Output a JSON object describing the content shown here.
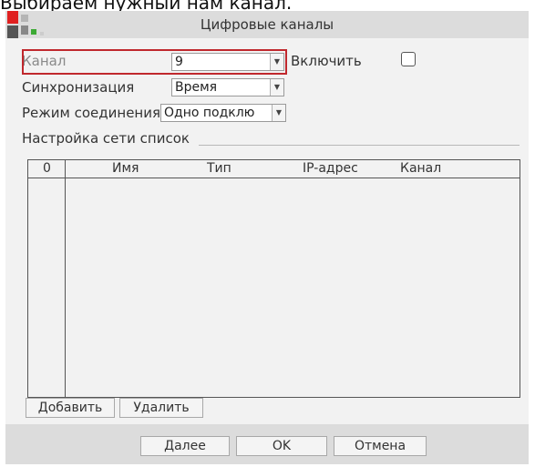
{
  "caption": "Выбираем нужный нам канал.",
  "window": {
    "title": "Цифровые каналы"
  },
  "form": {
    "channel_label": "Канал",
    "channel_value": "9",
    "enable_label": "Включить",
    "enable_checked": false,
    "sync_label": "Синхронизация",
    "sync_value": "Время",
    "conn_label": "Режим соединения",
    "conn_value": "Одно подклю"
  },
  "network": {
    "group_label": "Настройка сети список",
    "columns": [
      "0",
      "Имя",
      "Тип",
      "IP-адрес",
      "Канал"
    ],
    "rows": []
  },
  "buttons": {
    "add": "Добавить",
    "delete": "Удалить",
    "next": "Далее",
    "ok": "OK",
    "cancel": "Отмена"
  },
  "colors": {
    "highlight": "#c0282d",
    "logo_red": "#e02020",
    "logo_green": "#3daa35"
  }
}
